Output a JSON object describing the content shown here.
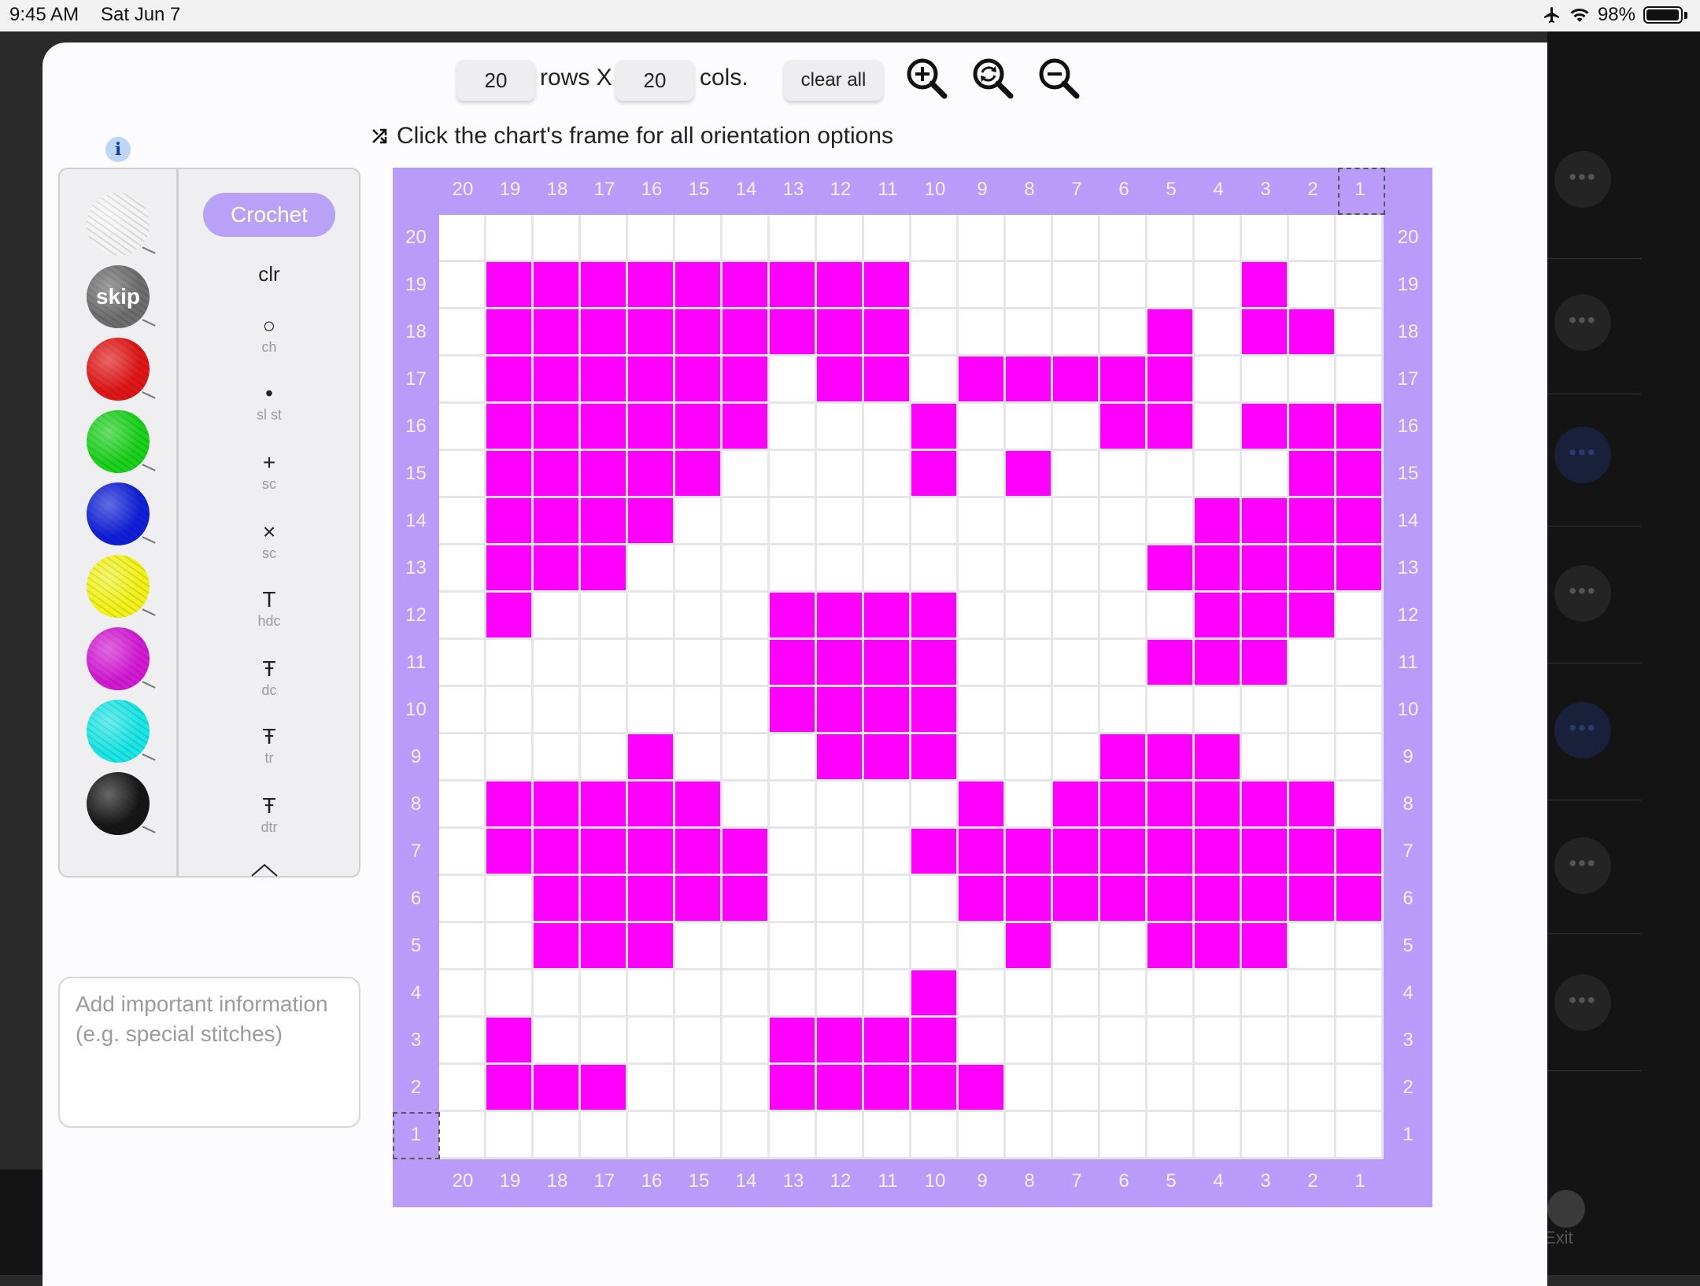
{
  "status_bar": {
    "time": "9:45 AM",
    "date": "Sat Jun 7",
    "battery": "98%"
  },
  "toolbar": {
    "rows_value": "20",
    "rows_label": "rows X",
    "cols_value": "20",
    "cols_label": "cols.",
    "clear_label": "clear all"
  },
  "hint": {
    "text": "Click the chart's frame for all orientation options"
  },
  "info_label": "i",
  "palette": {
    "colors": [
      {
        "name": "white",
        "hex": "#f3f3f3"
      },
      {
        "name": "skip",
        "hex": "#6d6d6d",
        "label": "skip"
      },
      {
        "name": "red",
        "hex": "#e01616"
      },
      {
        "name": "green",
        "hex": "#1bd11b"
      },
      {
        "name": "blue",
        "hex": "#1020d8"
      },
      {
        "name": "yellow",
        "hex": "#f2f21a"
      },
      {
        "name": "magenta",
        "hex": "#d31ad3"
      },
      {
        "name": "cyan",
        "hex": "#1ae6e6"
      },
      {
        "name": "black",
        "hex": "#161616"
      }
    ],
    "mode_label": "Crochet",
    "stitches": [
      {
        "symbol": "clr",
        "abbr": ""
      },
      {
        "symbol": "○",
        "abbr": "ch"
      },
      {
        "symbol": "•",
        "abbr": "sl st"
      },
      {
        "symbol": "+",
        "abbr": "sc"
      },
      {
        "symbol": "×",
        "abbr": "sc"
      },
      {
        "symbol": "T",
        "abbr": "hdc"
      },
      {
        "symbol": "Ŧ",
        "abbr": "dc"
      },
      {
        "symbol": "Ŧ",
        "abbr": "tr"
      },
      {
        "symbol": "Ŧ",
        "abbr": "dtr"
      }
    ]
  },
  "notes": {
    "placeholder": "Add important information (e.g. special stitches)"
  },
  "grid": {
    "rows": 20,
    "cols": 20,
    "fill_color": "#ff00ff",
    "frame_color": "#b99cf9",
    "col_labels": [
      "20",
      "19",
      "18",
      "17",
      "16",
      "15",
      "14",
      "13",
      "12",
      "11",
      "10",
      "9",
      "8",
      "7",
      "6",
      "5",
      "4",
      "3",
      "2",
      "1"
    ],
    "row_labels": [
      "20",
      "19",
      "18",
      "17",
      "16",
      "15",
      "14",
      "13",
      "12",
      "11",
      "10",
      "9",
      "8",
      "7",
      "6",
      "5",
      "4",
      "3",
      "2",
      "1"
    ],
    "filled_rows": [
      "....................",
      ".#########.......#..",
      ".#########.....#.##.",
      ".######.##.#####....",
      ".######...#...##.###",
      ".#####....#.#.....##",
      ".####...........####",
      ".###...........#####",
      ".#.....####.....###.",
      ".......####....###..",
      ".......####.........",
      "....#...###...###...",
      ".#####.....#.######.",
      ".######...##########",
      "..#####....#########",
      "..###.......#..###..",
      "..........#.........",
      ".#.....####.........",
      ".###...#####........",
      "...................."
    ]
  },
  "side_buttons": {
    "exit_label": "Exit"
  }
}
